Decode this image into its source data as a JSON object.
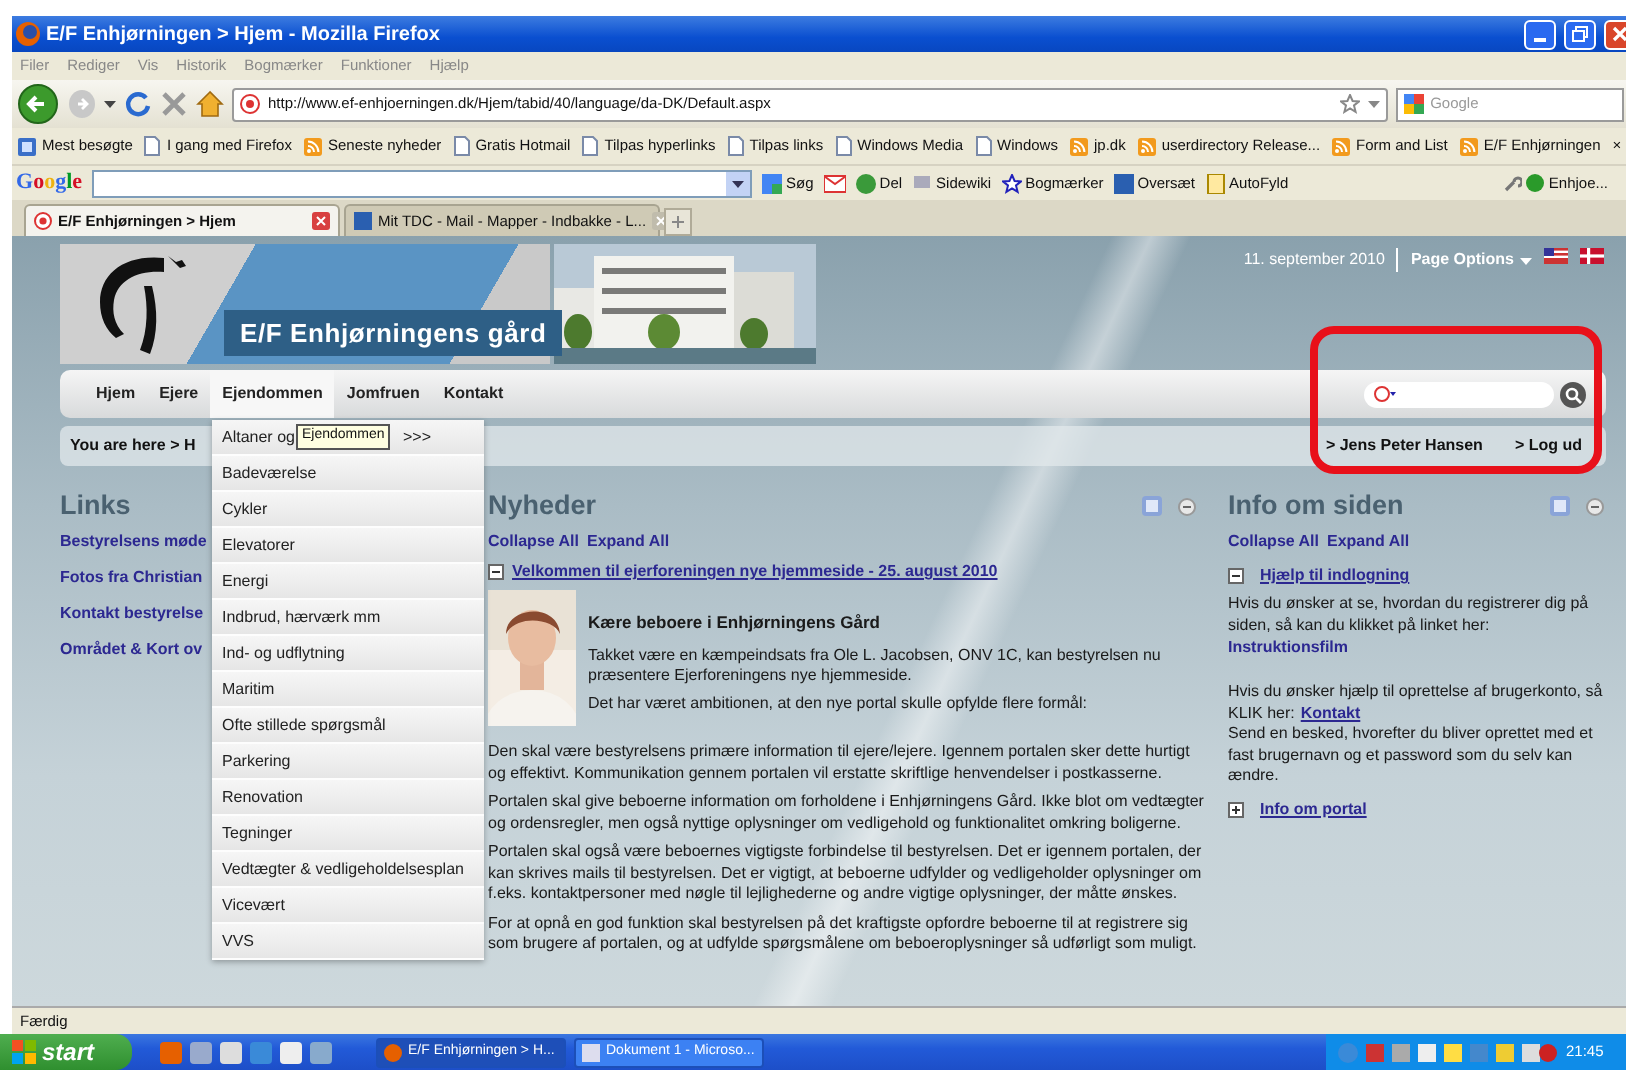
{
  "window": {
    "title": "E/F Enhjørningen > Hjem - Mozilla Firefox"
  },
  "menu_bar": [
    "Filer",
    "Rediger",
    "Vis",
    "Historik",
    "Bogmærker",
    "Funktioner",
    "Hjælp"
  ],
  "navigation": {
    "url": "http://www.ef-enhjoerningen.dk/Hjem/tabid/40/language/da-DK/Default.aspx",
    "search": {
      "placeholder": "Google"
    }
  },
  "bookmarks": [
    {
      "label": "Mest besøgte",
      "kind": "folder"
    },
    {
      "label": "I gang med Firefox",
      "kind": "page"
    },
    {
      "label": "Seneste nyheder",
      "kind": "feed"
    },
    {
      "label": "Gratis Hotmail",
      "kind": "page"
    },
    {
      "label": "Tilpas hyperlinks",
      "kind": "page"
    },
    {
      "label": "Tilpas links",
      "kind": "page"
    },
    {
      "label": "Windows Media",
      "kind": "page"
    },
    {
      "label": "Windows",
      "kind": "page"
    },
    {
      "label": "jp.dk",
      "kind": "feed"
    },
    {
      "label": "userdirectory Release...",
      "kind": "feed"
    },
    {
      "label": "Form and List",
      "kind": "feed"
    },
    {
      "label": "E/F Enhjørningen",
      "kind": "feed"
    }
  ],
  "bookmarks_close": "×",
  "google_toolbar": {
    "logo": "Google",
    "buttons": [
      "Søg",
      "Del",
      "Sidewiki",
      "Bogmærker",
      "Oversæt",
      "AutoFyld"
    ],
    "account": "Enhjoe..."
  },
  "tabs": [
    {
      "label": "E/F Enhjørningen > Hjem",
      "selected": true
    },
    {
      "label": "Mit TDC - Mail - Mapper - Indbakke - L...",
      "selected": false
    }
  ],
  "page": {
    "site_title": "E/F Enhjørningens gård",
    "date": "11. september 2010",
    "page_options": "Page Options",
    "nav": [
      {
        "label": "Hjem",
        "selected": false
      },
      {
        "label": "Ejere",
        "selected": false
      },
      {
        "label": "Ejendommen",
        "selected": true
      },
      {
        "label": "Jomfruen",
        "selected": false
      },
      {
        "label": "Kontakt",
        "selected": false
      }
    ],
    "dropdown": [
      {
        "label": "Altaner og",
        "suffix": ">>>"
      },
      {
        "label": "Badeværelse"
      },
      {
        "label": "Cykler"
      },
      {
        "label": "Elevatorer"
      },
      {
        "label": "Energi"
      },
      {
        "label": "Indbrud, hærværk mm"
      },
      {
        "label": "Ind- og udflytning"
      },
      {
        "label": "Maritim"
      },
      {
        "label": "Ofte stillede spørgsmål"
      },
      {
        "label": "Parkering"
      },
      {
        "label": "Renovation"
      },
      {
        "label": "Tegninger"
      },
      {
        "label": "Vedtægter & vedligeholdelsesplan"
      },
      {
        "label": "Vicevært"
      },
      {
        "label": "VVS"
      }
    ],
    "tooltip": "Ejendommen",
    "breadcrumb": {
      "prefix": "You are here >",
      "current": "H"
    },
    "user_links": [
      "> Jens Peter Hansen",
      "> Log ud"
    ],
    "links_panel": {
      "title": "Links",
      "items": [
        "Bestyrelsens møde",
        "Fotos fra Christian",
        "Kontakt bestyrelse",
        "Området & Kort ov"
      ]
    },
    "news_panel": {
      "title": "Nyheder",
      "collapse": "Collapse All",
      "expand": "Expand All",
      "article": {
        "title": "Velkommen til ejerforeningen nye hjemmeside - 25. august 2010",
        "expanded": true,
        "heading": "Kære beboere i Enhjørningens Gård",
        "intro": [
          "Takket være en kæmpeindsats fra Ole L. Jacobsen, ONV 1C, kan bestyrelsen nu præsentere Ejerforeningens nye hjemmeside.",
          "Det har været ambitionen, at den nye portal skulle opfylde flere formål:"
        ],
        "paragraphs": [
          "Den skal være bestyrelsens primære information til ejere/lejere. Igennem portalen sker dette hurtigt og effektivt. Kommunikation gennem portalen vil erstatte skriftlige henvendelser i postkasserne.",
          "Portalen skal give beboerne information om forholdene i Enhjørningens Gård. Ikke blot om vedtægter og ordensregler, men også nyttige oplysninger om vedligehold og funktionalitet omkring boligerne.",
          "Portalen skal også være beboernes vigtigste forbindelse til bestyrelsen. Det er igennem portalen, der kan skrives mails til bestyrelsen. Det er vigtigt, at beboerne udfylder og vedligeholder oplysninger om f.eks. kontaktpersoner med nøgle til lejlighederne og andre vigtige oplysninger, der måtte ønskes.",
          "For at opnå en god funktion skal bestyrelsen på det kraftigste opfordre beboerne til at registrere sig som brugere af portalen, og at udfylde spørgsmålene om beboeroplysninger så udførligt som muligt."
        ]
      }
    },
    "info_panel": {
      "title": "Info om siden",
      "collapse": "Collapse All",
      "expand": "Expand All",
      "sections": [
        {
          "title": "Hjælp til indlogning",
          "expanded": true,
          "blocks": [
            {
              "text": "Hvis du ønsker at se, hvordan du registrerer dig på siden, så kan du klikket på linket her:",
              "link": "Instruktionsfilm"
            },
            {
              "text": "Hvis du ønsker hjælp til oprettelse af brugerkonto, så KLIK her:",
              "link": "Kontakt",
              "after": "Send en besked, hvorefter du bliver oprettet med et fast brugernavn og et password som du selv kan ændre."
            }
          ]
        },
        {
          "title": "Info om portal",
          "expanded": false
        }
      ]
    }
  },
  "status_bar": "Færdig",
  "taskbar": {
    "start": "start",
    "buttons": [
      {
        "label": "E/F Enhjørningen > H...",
        "selected": true
      },
      {
        "label": "Dokument 1 - Microso...",
        "selected": false
      }
    ],
    "clock": "21:45"
  }
}
